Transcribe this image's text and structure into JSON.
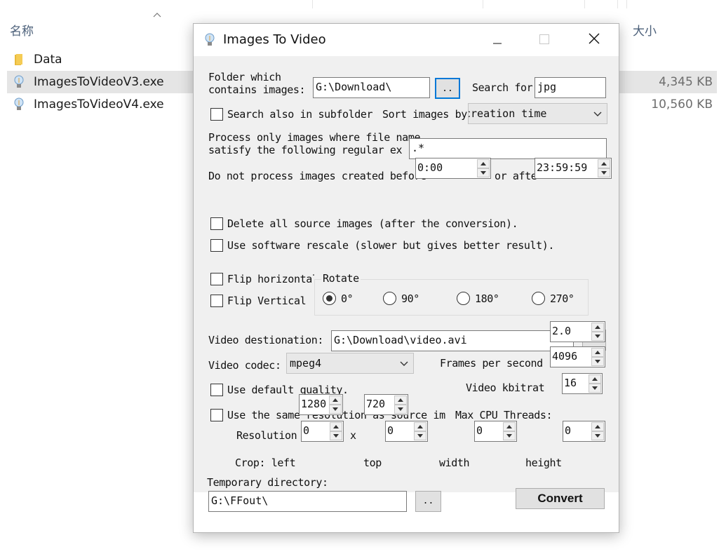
{
  "explorer": {
    "headers": {
      "name": "名称",
      "size": "大小"
    },
    "files": [
      {
        "name": "Data",
        "icon": "folder-icon",
        "size": ""
      },
      {
        "name": "ImagesToVideoV3.exe",
        "icon": "lightbulb-icon",
        "size": "4,345 KB"
      },
      {
        "name": "ImagesToVideoV4.exe",
        "icon": "lightbulb-icon",
        "size": "10,560 KB"
      }
    ]
  },
  "window": {
    "title": "Images To Video",
    "icon": "lightbulb-icon",
    "controls": [
      "minimize-icon",
      "maximize-icon",
      "close-icon"
    ]
  },
  "form": {
    "folder_label_1": "Folder which",
    "folder_label_2": "contains images:",
    "folder_value": "G:\\Download\\",
    "browse_label": "..",
    "search_for_label": "Search for",
    "search_for_value": "jpg",
    "subfolder_label": "Search also in subfolder",
    "sort_label": "Sort images by",
    "sort_value": "creation time",
    "regex_label_1": "Process only images where file name",
    "regex_label_2": "satisfy the following regular ex",
    "regex_value": ".*",
    "created_label": "Do not process images created before",
    "before_value": "0:00",
    "or_after_label": "or afte",
    "after_value": "23:59:59",
    "delete_label": "Delete all source images (after the conversion).",
    "rescale_label": "Use software rescale (slower but gives better result).",
    "flip_h_label": "Flip horizontal",
    "flip_v_label": "Flip Vertical",
    "rotate_label": "Rotate",
    "rotate_options": [
      "0°",
      "90°",
      "180°",
      "270°"
    ],
    "rotate_selected": "0°",
    "video_dest_label": "Video destionation:",
    "video_dest_value": "G:\\Download\\video.avi",
    "codec_label": "Video codec:",
    "codec_value": "mpeg4",
    "fps_label": "Frames per second",
    "fps_value": "2.0",
    "default_quality_label": "Use default quality.",
    "kbit_label": "Video kbitrat",
    "kbit_value": "4096",
    "same_res_label": "Use the same resolution as source im",
    "max_cpu_label": "Max CPU Threads:",
    "max_cpu_value": "16",
    "resolution_label": "Resolution",
    "res_w": "1280",
    "res_x": "x",
    "res_h": "720",
    "crop_label": "Crop: left",
    "crop_left": "0",
    "top_label": "top",
    "crop_top": "0",
    "width_label": "width",
    "crop_width": "0",
    "height_label": "height",
    "crop_height": "0",
    "temp_label": "Temporary directory:",
    "temp_value": "G:\\FFout\\",
    "convert_label": "Convert"
  }
}
